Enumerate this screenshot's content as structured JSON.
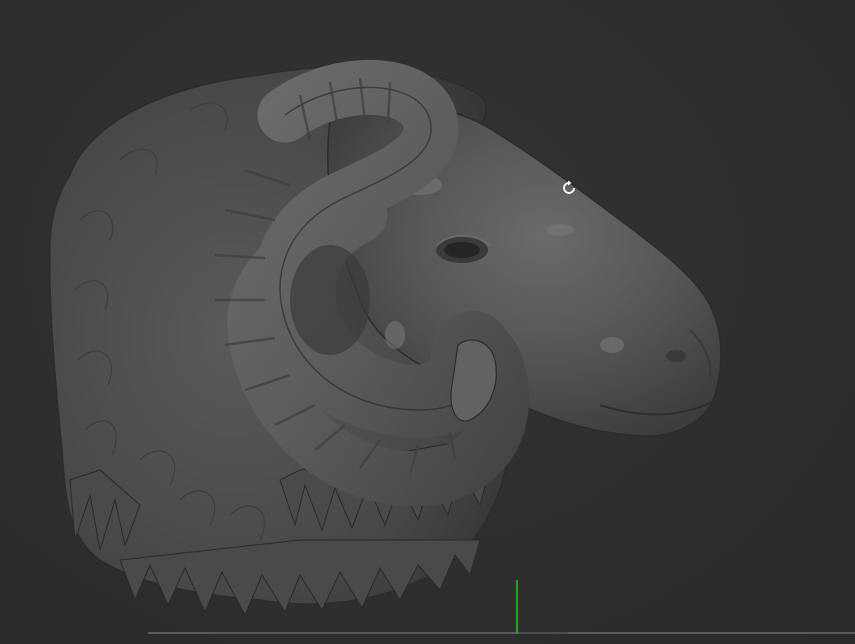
{
  "viewport": {
    "background_color": "#2f2f2f",
    "model_name": "ram-head-sculpt",
    "model_base_color": "#555555",
    "cursor_icon": "rotate-icon",
    "axis_color_y": "#1fa51f",
    "ground_line_color": "#5a5a5a"
  }
}
